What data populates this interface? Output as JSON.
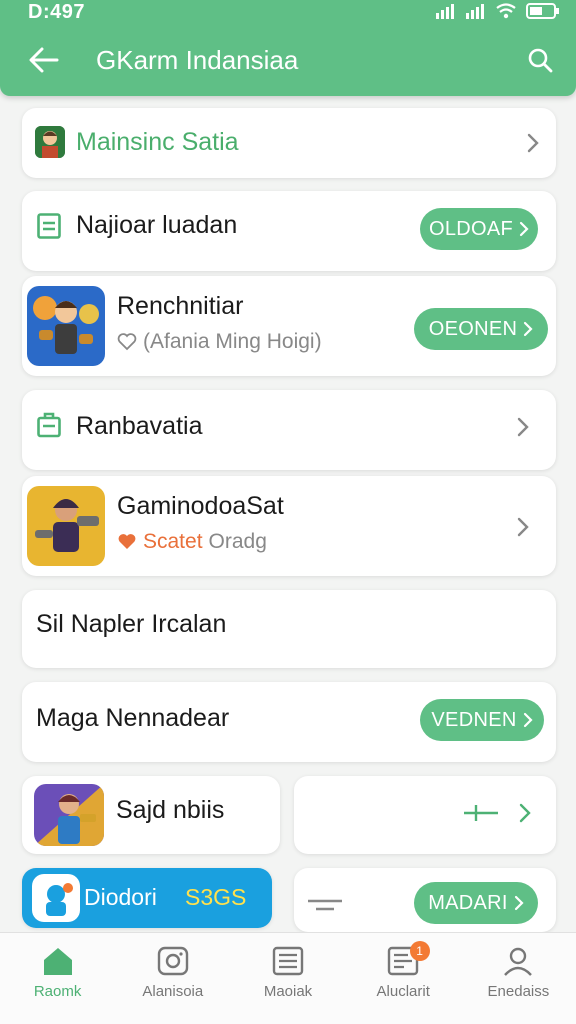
{
  "status": {
    "time": "D:497"
  },
  "header": {
    "title": "GKarm Indansiaa"
  },
  "rows": [
    {
      "label": "Mainsinc Satia"
    },
    {
      "label": "Najioar luadan",
      "button": "OLDOAF"
    },
    {
      "label": "Renchnitiar",
      "subtitle": "(Afania Ming Hoigi)",
      "button": "OEONEN"
    },
    {
      "label": "Ranbavatia"
    },
    {
      "label": "GaminodoaSat",
      "subtitle_accent": "Scatet",
      "subtitle": "Oradg"
    },
    {
      "label": "Sil Napler Ircalan"
    },
    {
      "label": "Maga Nennadear",
      "button": "VEDNEN"
    },
    {
      "label": "Sajd nbiis"
    },
    {
      "label": "Diodori",
      "accent": "S3GS",
      "button": "MADARI"
    }
  ],
  "colors": {
    "brand": "#5fbf86",
    "accent_orange": "#f37a34",
    "promo_blue": "#1aa0df",
    "promo_yellow": "#ffe14d"
  },
  "nav": [
    {
      "label": "Raomk",
      "icon": "home-icon"
    },
    {
      "label": "Alanisoia",
      "icon": "camera-icon"
    },
    {
      "label": "Maoiak",
      "icon": "list-icon"
    },
    {
      "label": "Aluclarit",
      "icon": "clipboard-icon",
      "badge": "1"
    },
    {
      "label": "Enedaiss",
      "icon": "profile-icon"
    }
  ]
}
